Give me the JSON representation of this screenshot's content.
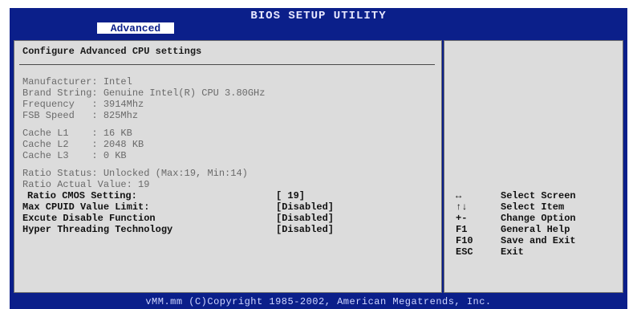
{
  "window": {
    "title": "BIOS SETUP UTILITY",
    "active_tab": "Advanced"
  },
  "section": {
    "heading": "Configure Advanced CPU settings"
  },
  "cpu_info": [
    "Manufacturer: Intel",
    "Brand String: Genuine Intel(R) CPU 3.80GHz",
    "Frequency   : 3914Mhz",
    "FSB Speed   : 825Mhz",
    "Cache L1    : 16 KB",
    "Cache L2    : 2048 KB",
    "Cache L3    : 0 KB",
    "Ratio Status: Unlocked (Max:19, Min:14)",
    "Ratio Actual Value: 19"
  ],
  "settings": [
    {
      "label": "Ratio CMOS Setting:",
      "value": "[ 19]"
    },
    {
      "label": "Max CPUID Value Limit:",
      "value": "[Disabled]"
    },
    {
      "label": "Excute Disable Function",
      "value": "[Disabled]"
    },
    {
      "label": "Hyper Threading Technology",
      "value": "[Disabled]"
    }
  ],
  "help": [
    {
      "key": "↔",
      "desc": "Select Screen"
    },
    {
      "key": "↑↓",
      "desc": "Select Item"
    },
    {
      "key": "+-",
      "desc": "Change Option"
    },
    {
      "key": "F1",
      "desc": "General Help"
    },
    {
      "key": "F10",
      "desc": "Save and Exit"
    },
    {
      "key": "ESC",
      "desc": "Exit"
    }
  ],
  "footer": {
    "text": "vMM.mm (C)Copyright 1985-2002, American Megatrends, Inc."
  },
  "colors": {
    "frame_blue": "#0b1f8a",
    "panel_gray": "#dcdcdc"
  }
}
